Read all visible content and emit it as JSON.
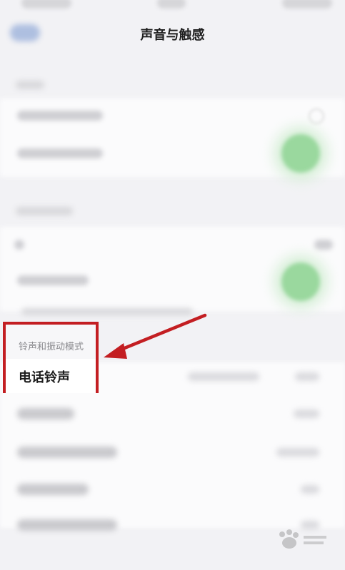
{
  "header": {
    "title": "声音与触感"
  },
  "ringtone_section": {
    "header": "铃声和振动模式",
    "first_item": "电话铃声"
  },
  "colors": {
    "highlight": "#c31e22",
    "toggle_on": "#4cbf56",
    "background": "#f2f2f5"
  },
  "icons": {
    "back": "back-arrow-icon",
    "arrow": "annotation-arrow-icon",
    "watermark": "baidu-logo-icon"
  }
}
